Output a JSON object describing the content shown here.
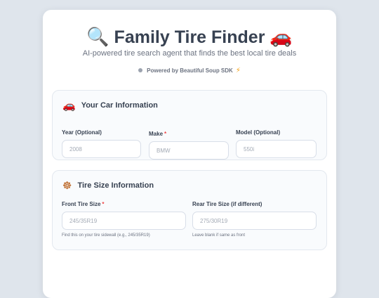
{
  "header": {
    "title_icon": "🔍",
    "title": "Family Tire Finder",
    "title_icon_right": "🚗",
    "subtitle": "AI-powered tire search agent that finds the best local tire deals",
    "powered_by": "Powered by Beautiful Soup SDK",
    "powered_icon": "⚡"
  },
  "car_section": {
    "icon": "🚗",
    "title": "Your Car Information",
    "fields": {
      "year": {
        "label": "Year (Optional)",
        "placeholder": "2008"
      },
      "make": {
        "label": "Make",
        "required_mark": "*",
        "placeholder": "BMW"
      },
      "model": {
        "label": "Model (Optional)",
        "placeholder": "550i"
      }
    }
  },
  "tire_section": {
    "icon": "☸",
    "title": "Tire Size Information",
    "fields": {
      "front": {
        "label": "Front Tire Size",
        "required_mark": "*",
        "placeholder": "245/35R19",
        "hint": "Find this on your tire sidewall (e.g., 245/35R19)"
      },
      "rear": {
        "label": "Rear Tire Size (if different)",
        "placeholder": "275/30R19",
        "hint": "Leave blank if same as front"
      }
    }
  },
  "colors": {
    "background": "#dfe5ec",
    "card": "#ffffff",
    "section_bg": "#f9fbfd",
    "required": "#ef4444",
    "bolt": "#f59e0b"
  }
}
